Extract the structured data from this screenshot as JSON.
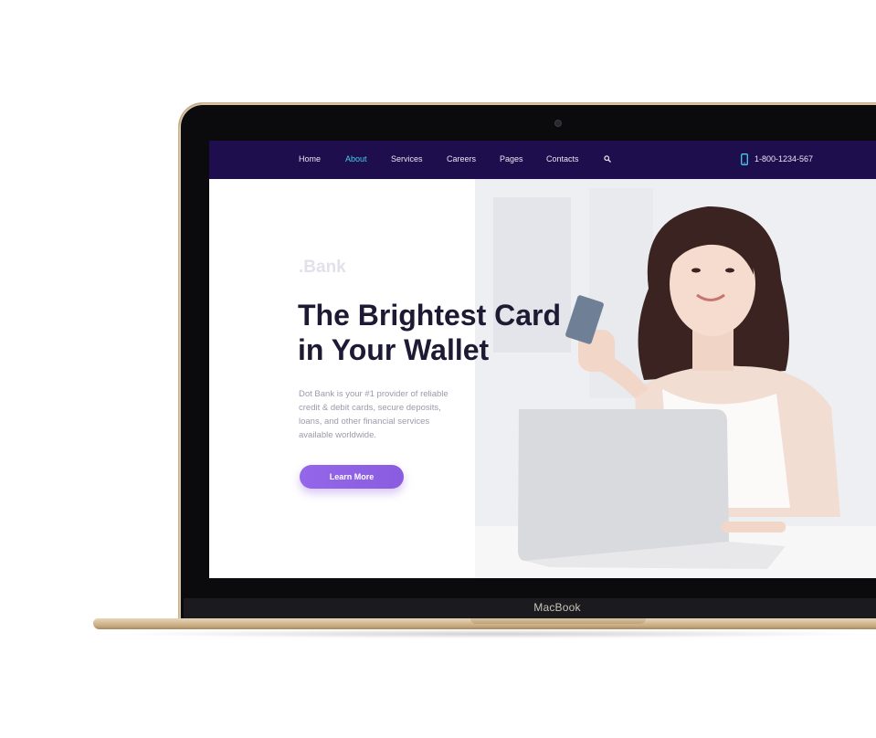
{
  "device": {
    "label": "MacBook"
  },
  "nav": {
    "items": [
      {
        "label": "Home",
        "active": false
      },
      {
        "label": "About",
        "active": true
      },
      {
        "label": "Services",
        "active": false
      },
      {
        "label": "Careers",
        "active": false
      },
      {
        "label": "Pages",
        "active": false
      },
      {
        "label": "Contacts",
        "active": false
      }
    ],
    "phone": "1-800-1234-567",
    "icons": {
      "search": "search-icon",
      "phone": "phone-icon"
    },
    "colors": {
      "background": "#1f0e4d",
      "active": "#3fd0e8"
    }
  },
  "hero": {
    "brand": ".Bank",
    "headline": [
      "The Brightest Card",
      "in Your Wallet"
    ],
    "description": "Dot Bank is your #1 provider of reliable credit & debit cards, secure deposits, loans, and other financial services available worldwide.",
    "button_label": "Learn More",
    "button_color": "#8f60e5"
  }
}
